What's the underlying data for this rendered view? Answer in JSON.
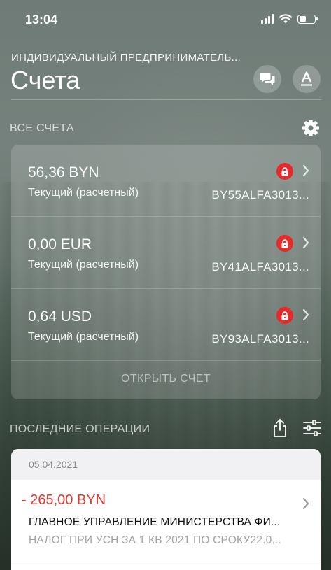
{
  "status_bar": {
    "time": "13:04"
  },
  "header": {
    "company": "ИНДИВИДУАЛЬНЫЙ ПРЕДПРИНИМАТЕЛЬ...",
    "title": "Счета",
    "chat_icon": "chat-bubbles-icon",
    "font_icon": "font-size-icon"
  },
  "accounts_section": {
    "label": "ВСЕ СЧЕТА",
    "settings_icon": "gear-icon",
    "items": [
      {
        "amount": "56,36 BYN",
        "type": "Текущий (расчетный)",
        "number": "BY55ALFA3013...",
        "locked": true
      },
      {
        "amount": "0,00 EUR",
        "type": "Текущий (расчетный)",
        "number": "BY41ALFA3013...",
        "locked": true
      },
      {
        "amount": "0,64 USD",
        "type": "Текущий (расчетный)",
        "number": "BY93ALFA3013...",
        "locked": true
      }
    ],
    "open_account_label": "ОТКРЫТЬ СЧЕТ"
  },
  "recent_section": {
    "label": "ПОСЛЕДНИЕ ОПЕРАЦИИ",
    "share_icon": "share-icon",
    "filter_icon": "filter-sliders-icon",
    "date": "05.04.2021",
    "operations": [
      {
        "amount": "- 265,00 BYN",
        "title": "ГЛАВНОЕ УПРАВЛЕНИЕ МИНИСТЕРСТВА ФИ...",
        "subtitle": "НАЛОГ ПРИ УСН ЗА 1 КВ 2021 ПО СРОКУ22.0..."
      }
    ]
  },
  "colors": {
    "lock_badge": "#e52a2a",
    "negative_amount": "#e03a2f"
  }
}
